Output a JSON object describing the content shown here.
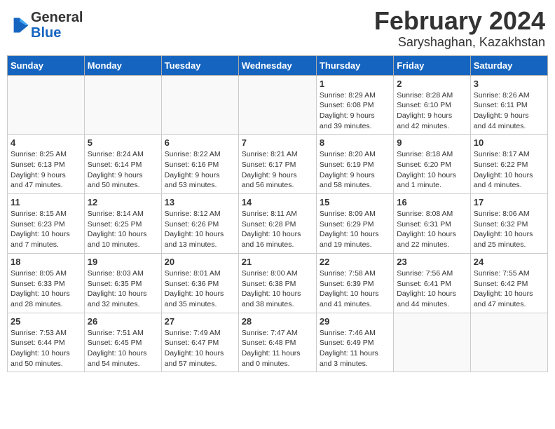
{
  "header": {
    "logo_general": "General",
    "logo_blue": "Blue",
    "month": "February 2024",
    "location": "Saryshaghan, Kazakhstan"
  },
  "days_of_week": [
    "Sunday",
    "Monday",
    "Tuesday",
    "Wednesday",
    "Thursday",
    "Friday",
    "Saturday"
  ],
  "weeks": [
    {
      "days": [
        {
          "number": "",
          "info": ""
        },
        {
          "number": "",
          "info": ""
        },
        {
          "number": "",
          "info": ""
        },
        {
          "number": "",
          "info": ""
        },
        {
          "number": "1",
          "info": "Sunrise: 8:29 AM\nSunset: 6:08 PM\nDaylight: 9 hours\nand 39 minutes."
        },
        {
          "number": "2",
          "info": "Sunrise: 8:28 AM\nSunset: 6:10 PM\nDaylight: 9 hours\nand 42 minutes."
        },
        {
          "number": "3",
          "info": "Sunrise: 8:26 AM\nSunset: 6:11 PM\nDaylight: 9 hours\nand 44 minutes."
        }
      ]
    },
    {
      "days": [
        {
          "number": "4",
          "info": "Sunrise: 8:25 AM\nSunset: 6:13 PM\nDaylight: 9 hours\nand 47 minutes."
        },
        {
          "number": "5",
          "info": "Sunrise: 8:24 AM\nSunset: 6:14 PM\nDaylight: 9 hours\nand 50 minutes."
        },
        {
          "number": "6",
          "info": "Sunrise: 8:22 AM\nSunset: 6:16 PM\nDaylight: 9 hours\nand 53 minutes."
        },
        {
          "number": "7",
          "info": "Sunrise: 8:21 AM\nSunset: 6:17 PM\nDaylight: 9 hours\nand 56 minutes."
        },
        {
          "number": "8",
          "info": "Sunrise: 8:20 AM\nSunset: 6:19 PM\nDaylight: 9 hours\nand 58 minutes."
        },
        {
          "number": "9",
          "info": "Sunrise: 8:18 AM\nSunset: 6:20 PM\nDaylight: 10 hours\nand 1 minute."
        },
        {
          "number": "10",
          "info": "Sunrise: 8:17 AM\nSunset: 6:22 PM\nDaylight: 10 hours\nand 4 minutes."
        }
      ]
    },
    {
      "days": [
        {
          "number": "11",
          "info": "Sunrise: 8:15 AM\nSunset: 6:23 PM\nDaylight: 10 hours\nand 7 minutes."
        },
        {
          "number": "12",
          "info": "Sunrise: 8:14 AM\nSunset: 6:25 PM\nDaylight: 10 hours\nand 10 minutes."
        },
        {
          "number": "13",
          "info": "Sunrise: 8:12 AM\nSunset: 6:26 PM\nDaylight: 10 hours\nand 13 minutes."
        },
        {
          "number": "14",
          "info": "Sunrise: 8:11 AM\nSunset: 6:28 PM\nDaylight: 10 hours\nand 16 minutes."
        },
        {
          "number": "15",
          "info": "Sunrise: 8:09 AM\nSunset: 6:29 PM\nDaylight: 10 hours\nand 19 minutes."
        },
        {
          "number": "16",
          "info": "Sunrise: 8:08 AM\nSunset: 6:31 PM\nDaylight: 10 hours\nand 22 minutes."
        },
        {
          "number": "17",
          "info": "Sunrise: 8:06 AM\nSunset: 6:32 PM\nDaylight: 10 hours\nand 25 minutes."
        }
      ]
    },
    {
      "days": [
        {
          "number": "18",
          "info": "Sunrise: 8:05 AM\nSunset: 6:33 PM\nDaylight: 10 hours\nand 28 minutes."
        },
        {
          "number": "19",
          "info": "Sunrise: 8:03 AM\nSunset: 6:35 PM\nDaylight: 10 hours\nand 32 minutes."
        },
        {
          "number": "20",
          "info": "Sunrise: 8:01 AM\nSunset: 6:36 PM\nDaylight: 10 hours\nand 35 minutes."
        },
        {
          "number": "21",
          "info": "Sunrise: 8:00 AM\nSunset: 6:38 PM\nDaylight: 10 hours\nand 38 minutes."
        },
        {
          "number": "22",
          "info": "Sunrise: 7:58 AM\nSunset: 6:39 PM\nDaylight: 10 hours\nand 41 minutes."
        },
        {
          "number": "23",
          "info": "Sunrise: 7:56 AM\nSunset: 6:41 PM\nDaylight: 10 hours\nand 44 minutes."
        },
        {
          "number": "24",
          "info": "Sunrise: 7:55 AM\nSunset: 6:42 PM\nDaylight: 10 hours\nand 47 minutes."
        }
      ]
    },
    {
      "days": [
        {
          "number": "25",
          "info": "Sunrise: 7:53 AM\nSunset: 6:44 PM\nDaylight: 10 hours\nand 50 minutes."
        },
        {
          "number": "26",
          "info": "Sunrise: 7:51 AM\nSunset: 6:45 PM\nDaylight: 10 hours\nand 54 minutes."
        },
        {
          "number": "27",
          "info": "Sunrise: 7:49 AM\nSunset: 6:47 PM\nDaylight: 10 hours\nand 57 minutes."
        },
        {
          "number": "28",
          "info": "Sunrise: 7:47 AM\nSunset: 6:48 PM\nDaylight: 11 hours\nand 0 minutes."
        },
        {
          "number": "29",
          "info": "Sunrise: 7:46 AM\nSunset: 6:49 PM\nDaylight: 11 hours\nand 3 minutes."
        },
        {
          "number": "",
          "info": ""
        },
        {
          "number": "",
          "info": ""
        }
      ]
    }
  ]
}
